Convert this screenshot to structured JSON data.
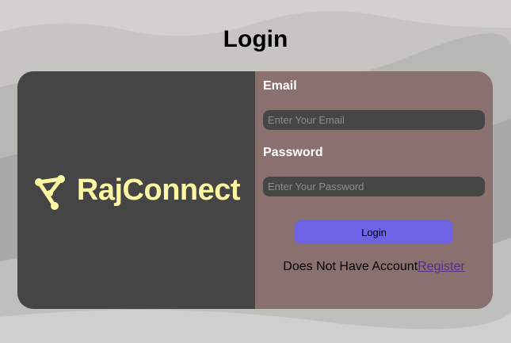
{
  "page": {
    "title": "Login"
  },
  "brand": {
    "name": "RajConnect",
    "logo_icon": "network-triangle-icon",
    "name_color": "#fdf6a3"
  },
  "form": {
    "email_label": "Email",
    "email_placeholder": "Enter Your Email",
    "password_label": "Password",
    "password_placeholder": "Enter Your Password",
    "login_label": "Login",
    "register_prompt": "Does Not Have Account",
    "register_link": "Register"
  },
  "colors": {
    "brand_panel": "#454545",
    "form_panel": "#8a7170",
    "button": "#6e62e5",
    "link": "#5b2c86"
  }
}
